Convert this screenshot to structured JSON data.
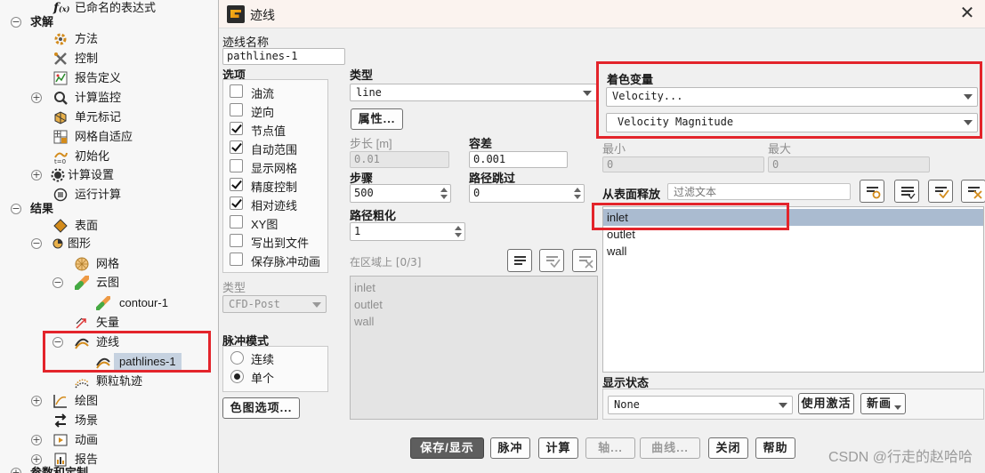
{
  "tree": {
    "items": [
      {
        "label": "已命名的表达式",
        "icon": "fx-icon"
      },
      {
        "label": "求解",
        "icon": "none"
      },
      {
        "label": "方法",
        "icon": "methods-icon"
      },
      {
        "label": "控制",
        "icon": "controls-icon"
      },
      {
        "label": "报告定义",
        "icon": "report-definitions-icon"
      },
      {
        "label": "计算监控",
        "icon": "monitors-icon"
      },
      {
        "label": "单元标记",
        "icon": "cell-registers-icon"
      },
      {
        "label": "网格自适应",
        "icon": "mesh-adaption-icon"
      },
      {
        "label": "初始化",
        "icon": "initialization-icon"
      },
      {
        "label": "计算设置",
        "icon": "calculation-activities-icon"
      },
      {
        "label": "运行计算",
        "icon": "run-calculation-icon"
      },
      {
        "label": "结果",
        "icon": "none"
      },
      {
        "label": "表面",
        "icon": "surfaces-icon"
      },
      {
        "label": "图形",
        "icon": "graphics-icon"
      },
      {
        "label": "网格",
        "icon": "mesh-icon"
      },
      {
        "label": "云图",
        "icon": "contours-icon"
      },
      {
        "label": "contour-1",
        "icon": "contour-item-icon"
      },
      {
        "label": "矢量",
        "icon": "vectors-icon"
      },
      {
        "label": "迹线",
        "icon": "pathlines-icon"
      },
      {
        "label": "pathlines-1",
        "icon": "pathline-item-icon"
      },
      {
        "label": "颗粒轨迹",
        "icon": "particle-tracks-icon"
      },
      {
        "label": "绘图",
        "icon": "plots-icon"
      },
      {
        "label": "场景",
        "icon": "scene-icon"
      },
      {
        "label": "动画",
        "icon": "animations-icon"
      },
      {
        "label": "报告",
        "icon": "reports-icon"
      },
      {
        "label": "参数和定制",
        "icon": "none"
      }
    ]
  },
  "dialog": {
    "title": "迹线",
    "close_glyph": "✕",
    "name_label": "迹线名称",
    "name_value": "pathlines-1",
    "options_label": "选项",
    "options": [
      {
        "label": "油流",
        "checked": false
      },
      {
        "label": "逆向",
        "checked": false
      },
      {
        "label": "节点值",
        "checked": true
      },
      {
        "label": "自动范围",
        "checked": true
      },
      {
        "label": "显示网格",
        "checked": false
      },
      {
        "label": "精度控制",
        "checked": true
      },
      {
        "label": "相对迹线",
        "checked": true
      },
      {
        "label": "XY图",
        "checked": false
      },
      {
        "label": "写出到文件",
        "checked": false
      },
      {
        "label": "保存脉冲动画",
        "checked": false
      }
    ],
    "type_label": "类型",
    "type_value": "line",
    "attributes_button": "属性...",
    "step_size_label": "步长 [m]",
    "step_size_value": "0.01",
    "tolerance_label": "容差",
    "tolerance_value": "0.001",
    "steps_label": "步骤",
    "steps_value": "500",
    "path_skip_label": "路径跳过",
    "path_skip_value": "0",
    "path_coarsen_label": "路径粗化",
    "path_coarsen_value": "1",
    "on_zone_label": "在区域上 [0/3]",
    "zone_list": [
      "inlet",
      "outlet",
      "wall"
    ],
    "type2_label": "类型",
    "type2_value": "CFD-Post",
    "pulse_mode_label": "脉冲模式",
    "pulse_modes": [
      {
        "label": "连续",
        "selected": false
      },
      {
        "label": "单个",
        "selected": true
      }
    ],
    "colormap_button": "色图选项...",
    "color_var_label": "着色变量",
    "color_var_1": "Velocity...",
    "color_var_2": "Velocity Magnitude",
    "min_label": "最小",
    "min_value": "0",
    "max_label": "最大",
    "max_value": "0",
    "release_label": "从表面释放",
    "filter_placeholder": "过滤文本",
    "release_list": [
      "inlet",
      "outlet",
      "wall"
    ],
    "display_state_label": "显示状态",
    "display_state_value": "None",
    "use_active_button": "使用激活",
    "new_button": "新画",
    "bottom_buttons": {
      "save_display": "保存/显示",
      "pulse": "脉冲",
      "compute": "计算",
      "axes": "轴...",
      "curves": "曲线...",
      "close": "关闭",
      "help": "帮助"
    }
  },
  "watermark": "CSDN @行走的赵哈哈",
  "colors": {
    "highlight_red": "#e3242b",
    "selection_blue": "#aabbd0",
    "primary_button": "#5e5e5e"
  }
}
